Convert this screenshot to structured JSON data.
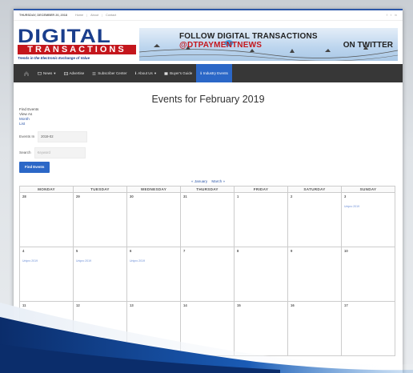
{
  "util_bar": {
    "date": "THURSDAY, DECEMBER 20, 2018",
    "links": [
      "Home",
      "About",
      "Contact"
    ],
    "social": [
      "f",
      "t",
      "in"
    ]
  },
  "logo": {
    "line1": "DIGITAL",
    "line2": "TRANSACTIONS",
    "tagline": "Trends in the Electronic Exchange of Value"
  },
  "banner": {
    "line1_prefix": "FOLLOW DIGITAL TRANSACTIONS",
    "handle": "@DTPAYMENTNEWS",
    "line2": "ON TWITTER"
  },
  "nav": {
    "items": [
      {
        "label": "News",
        "icon": "monitor-icon",
        "dropdown": true
      },
      {
        "label": "Advertise",
        "icon": "grid-icon",
        "dropdown": false
      },
      {
        "label": "Subscriber Center",
        "icon": "list-icon",
        "dropdown": false
      },
      {
        "label": "About Us",
        "icon": "info-icon",
        "dropdown": true
      },
      {
        "label": "Buyer's Guide",
        "icon": "book-icon",
        "dropdown": false
      },
      {
        "label": "Industry Events",
        "icon": "info-icon",
        "dropdown": false
      }
    ],
    "active_index": 5,
    "home_icon": "home-icon"
  },
  "page_title": "Events for February 2019",
  "filters": {
    "find_events": "Find Events",
    "view_as": "View As",
    "view_month": "Month",
    "view_list": "List",
    "events_in_label": "Events In",
    "events_in_value": "2019-02",
    "search_label": "Search",
    "search_placeholder": "Keyword",
    "button": "Find Events"
  },
  "pager": {
    "prev": "« January",
    "next": "March »"
  },
  "calendar": {
    "days": [
      "MONDAY",
      "TUESDAY",
      "WEDNESDAY",
      "THURSDAY",
      "FRIDAY",
      "SATURDAY",
      "SUNDAY"
    ],
    "weeks": [
      [
        {
          "d": "28",
          "e": ""
        },
        {
          "d": "29",
          "e": ""
        },
        {
          "d": "30",
          "e": ""
        },
        {
          "d": "31",
          "e": ""
        },
        {
          "d": "1",
          "e": ""
        },
        {
          "d": "2",
          "e": ""
        },
        {
          "d": "3",
          "e": "Unipro 2019"
        }
      ],
      [
        {
          "d": "4",
          "e": "Unipro 2019"
        },
        {
          "d": "5",
          "e": "Unipro 2019"
        },
        {
          "d": "6",
          "e": "Unipro 2019"
        },
        {
          "d": "7",
          "e": ""
        },
        {
          "d": "8",
          "e": ""
        },
        {
          "d": "9",
          "e": ""
        },
        {
          "d": "10",
          "e": ""
        }
      ],
      [
        {
          "d": "11",
          "e": ""
        },
        {
          "d": "12",
          "e": ""
        },
        {
          "d": "13",
          "e": ""
        },
        {
          "d": "14",
          "e": ""
        },
        {
          "d": "15",
          "e": ""
        },
        {
          "d": "16",
          "e": ""
        },
        {
          "d": "17",
          "e": ""
        }
      ]
    ]
  },
  "colors": {
    "brand_blue": "#1a3e8c",
    "brand_red": "#c4161c",
    "nav_bg": "#373737",
    "active_blue": "#2b67c7",
    "swoosh_dark": "#0b2d6b",
    "swoosh_light": "#2f7fd0"
  }
}
